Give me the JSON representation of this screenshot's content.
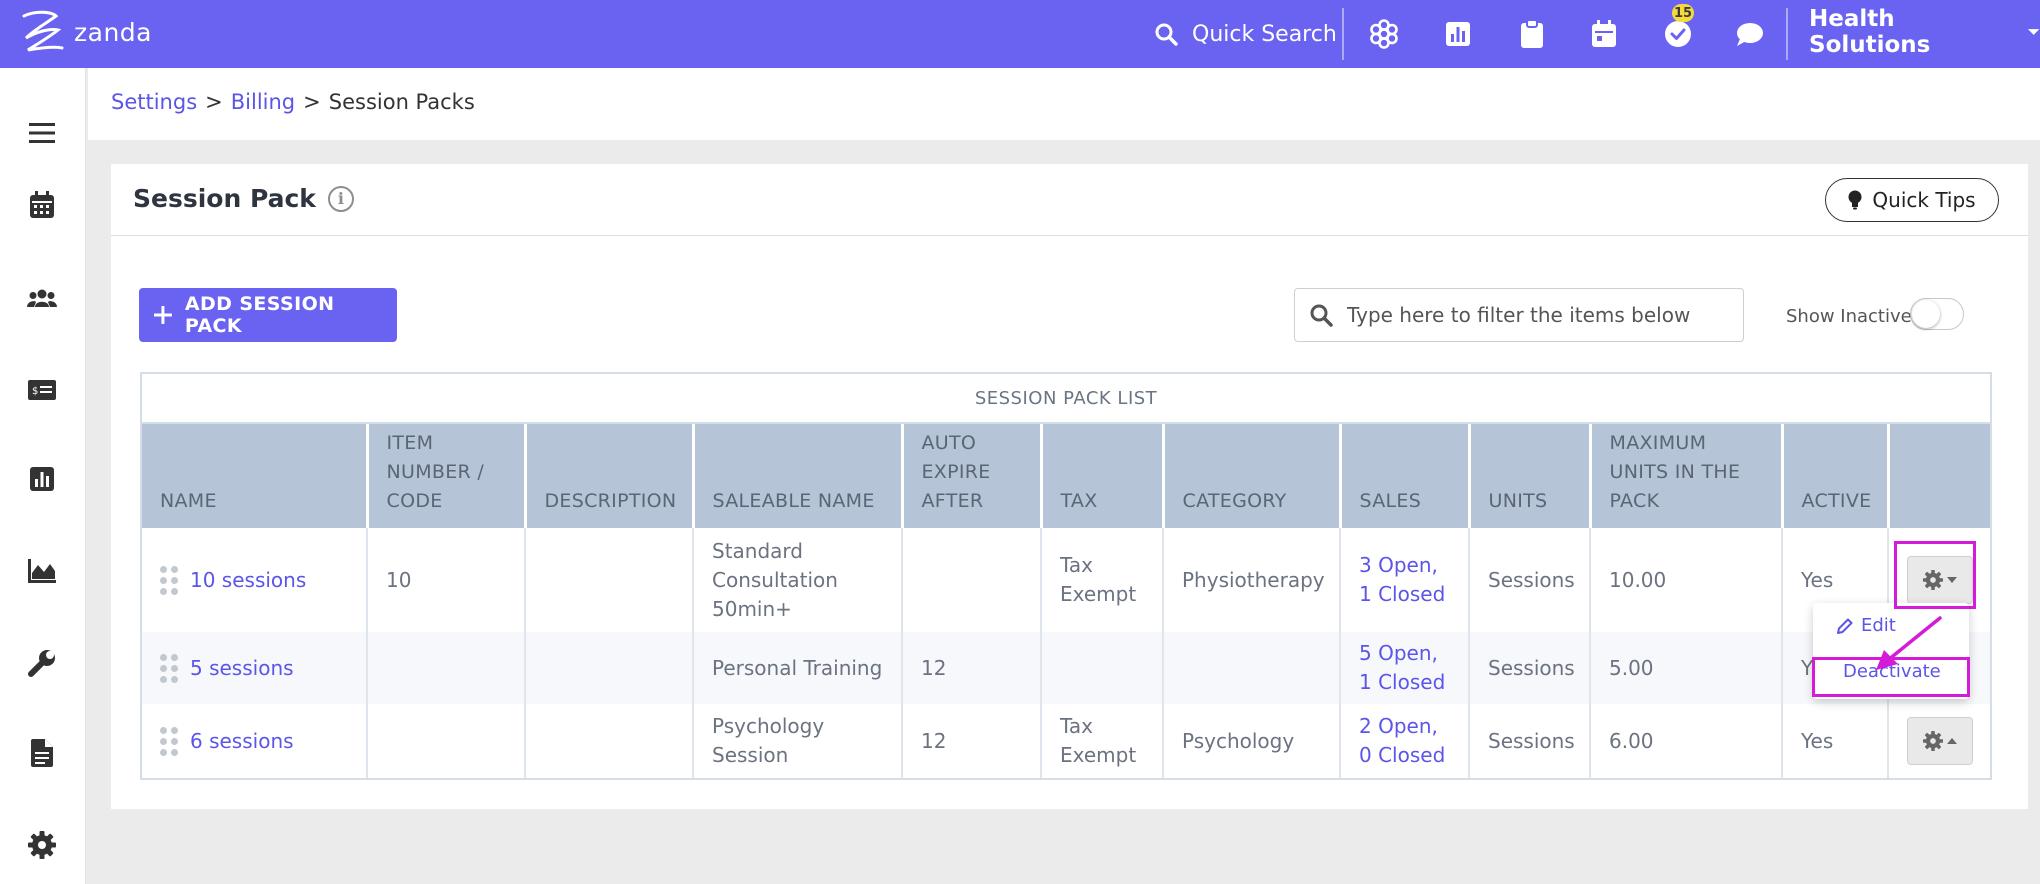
{
  "topbar": {
    "brand": "zanda",
    "quick_search_label": "Quick Search",
    "notification_count": "15",
    "org_name": "Health Solutions",
    "icons": [
      "search-icon",
      "integrations-icon",
      "reports-icon",
      "clipboard-icon",
      "calendar-icon",
      "tasks-check-icon",
      "chat-icon",
      "caret-down-icon"
    ],
    "bg_color": "#6a63f2"
  },
  "sidebar": {
    "items": [
      "menu-icon",
      "calendar-icon",
      "clients-icon",
      "billing-icon",
      "reports-icon",
      "analytics-icon",
      "tools-icon",
      "documents-icon",
      "settings-icon"
    ]
  },
  "breadcrumb": {
    "items": [
      {
        "label": "Settings",
        "link": true
      },
      {
        "label": "Billing",
        "link": true
      },
      {
        "label": "Session Packs",
        "link": false
      }
    ],
    "separator": ">"
  },
  "page": {
    "title": "Session Pack",
    "quick_tips_label": "Quick Tips",
    "add_button_label": "ADD SESSION PACK",
    "filter_placeholder": "Type here to filter the items below",
    "show_inactive_label": "Show Inactive",
    "show_inactive_on": false
  },
  "table": {
    "caption": "SESSION PACK LIST",
    "headers": [
      "NAME",
      "ITEM NUMBER / CODE",
      "DESCRIPTION",
      "SALEABLE NAME",
      "AUTO EXPIRE AFTER",
      "TAX",
      "CATEGORY",
      "SALES",
      "UNITS",
      "MAXIMUM UNITS IN THE PACK",
      "ACTIVE",
      ""
    ],
    "rows": [
      {
        "name": "10 sessions",
        "code": "10",
        "description": "",
        "saleable_name": "Standard Consultation 50min+",
        "auto_expire": "",
        "tax": "Tax Exempt",
        "category": "Physiotherapy",
        "sales": "3 Open, 1 Closed",
        "units": "Sessions",
        "max_units": "10.00",
        "active": "Yes"
      },
      {
        "name": "5 sessions",
        "code": "",
        "description": "",
        "saleable_name": "Personal Training",
        "auto_expire": "12",
        "tax": "",
        "category": "",
        "sales": "5 Open, 1 Closed",
        "units": "Sessions",
        "max_units": "5.00",
        "active": "Y"
      },
      {
        "name": "6 sessions",
        "code": "",
        "description": "",
        "saleable_name": "Psychology Session",
        "auto_expire": "12",
        "tax": "Tax Exempt",
        "category": "Psychology",
        "sales": "2 Open, 0 Closed",
        "units": "Sessions",
        "max_units": "6.00",
        "active": "Yes"
      }
    ]
  },
  "row_menu": {
    "edit_label": "Edit",
    "deactivate_label": "Deactivate"
  },
  "colors": {
    "accent": "#6a63f2",
    "link": "#5b55e8",
    "highlight": "#d41bd8",
    "header_bg": "#b6c4d7"
  }
}
